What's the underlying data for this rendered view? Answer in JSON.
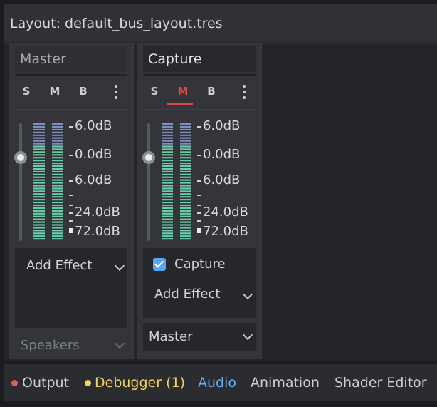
{
  "layout": {
    "title": "Layout: default_bus_layout.tres"
  },
  "buses": [
    {
      "name": "Master",
      "solo": "S",
      "mute": "M",
      "bypass": "B",
      "mute_active": false,
      "volume_db": 0.0,
      "db_labels": [
        "6.0dB",
        "0.0dB",
        "6.0dB",
        "24.0dB",
        "72.0dB"
      ],
      "add_effect": "Add Effect",
      "effects": [],
      "send": "Speakers"
    },
    {
      "name": "Capture",
      "solo": "S",
      "mute": "M",
      "bypass": "B",
      "mute_active": true,
      "volume_db": 0.0,
      "db_labels": [
        "6.0dB",
        "0.0dB",
        "6.0dB",
        "24.0dB",
        "72.0dB"
      ],
      "effects": [
        {
          "name": "Capture",
          "enabled": true
        }
      ],
      "add_effect": "Add Effect",
      "send": "Master"
    }
  ],
  "bottom_tabs": [
    {
      "label": "Output",
      "dot_color": "#e0605a"
    },
    {
      "label": "Debugger (1)",
      "dot_color": "#f2d45a",
      "color": "#f2d45a"
    },
    {
      "label": "Audio",
      "color": "#6aaef5",
      "active": true
    },
    {
      "label": "Animation"
    },
    {
      "label": "Shader Editor"
    }
  ],
  "colors": {
    "accent": "#5aa2f2",
    "mute": "#e04848",
    "meter_low": "#6fe0b8",
    "meter_high": "#8da0d8"
  }
}
